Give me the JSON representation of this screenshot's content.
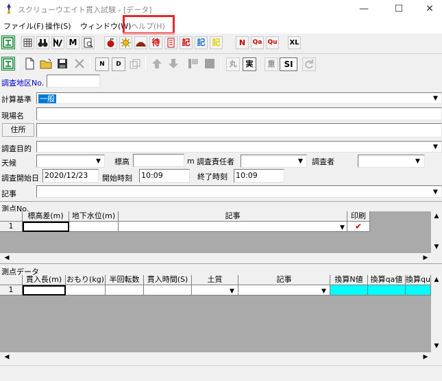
{
  "window": {
    "title": "スクリューウエイト貫入試験 - [データ]",
    "minimize": "—",
    "maximize": "☐",
    "close": "✕"
  },
  "menu": [
    {
      "label": "ファイル(F)"
    },
    {
      "label": "操作(S)"
    },
    {
      "label": "ウィンドウ(W)"
    },
    {
      "label": "ヘルプ(H)"
    }
  ],
  "toolbar1": {
    "n": "N",
    "qa": "Qa",
    "qu": "Qu",
    "xl": "XL",
    "ki1": "記",
    "ki2": "記",
    "ki3": "記",
    "matsu": "待",
    "m": "M"
  },
  "toolbar2": {
    "maru": "丸",
    "jitsu": "実",
    "juu": "重",
    "si": "SI",
    "n_btn": "N",
    "d_btn": "D"
  },
  "form": {
    "survey_no_label": "調査地区No.",
    "survey_no_value": "",
    "calc_label": "計算基準",
    "calc_value": "一般",
    "site_label": "現場名",
    "site_value": "",
    "address_button": "住所",
    "address_value": "",
    "purpose_label": "調査目的",
    "purpose_value": "",
    "weather_label": "天候",
    "weather_value": "",
    "elevation_label": "標高",
    "elevation_value": "",
    "elevation_unit": "m",
    "manager_label": "調査責任者",
    "manager_value": "",
    "surveyor_label": "調査者",
    "surveyor_value": "",
    "start_date_label": "調査開始日",
    "start_date_value": "2020/12/23",
    "start_time_label": "開始時刻",
    "start_time_value": "10:09",
    "end_time_label": "終了時刻",
    "end_time_value": "10:09",
    "note_label": "記事",
    "note_value": ""
  },
  "points": {
    "section_label": "測点No.",
    "headers": [
      "標高差(m)",
      "地下水位(m)",
      "記事",
      "印刷"
    ],
    "row_number": "1",
    "print_mark": "✔"
  },
  "data": {
    "section_label": "測点データ",
    "headers": [
      "貫入長(m)",
      "おもり(kg)",
      "半回転数",
      "貫入時間(S)",
      "土質",
      "記事",
      "換算N値",
      "換算qa値",
      "換算qu"
    ],
    "row_number": "1"
  },
  "colors": {
    "highlight": "#e8262a",
    "calc_select": "#0078d7",
    "cyan": "#00ffff",
    "grid_bg": "#aaaaaa"
  }
}
